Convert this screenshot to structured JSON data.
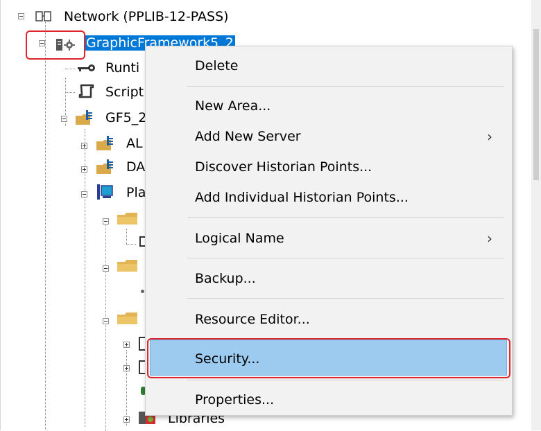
{
  "tree": {
    "root_label": "Network (PPLIB-12-PASS)",
    "selected_label": "GraphicFramework5_2",
    "runtime_label": "Runti",
    "script_label": "Script",
    "gf5_label": "GF5_2",
    "al_label": "AL",
    "da_label": "DA",
    "pla_label": "Pla",
    "libraries_label": "Libraries"
  },
  "context_menu": {
    "items": [
      {
        "label": "Delete",
        "submenu": false
      },
      {
        "label": "New Area...",
        "submenu": false
      },
      {
        "label": "Add New Server",
        "submenu": true
      },
      {
        "label": "Discover Historian Points...",
        "submenu": false
      },
      {
        "label": "Add Individual Historian Points...",
        "submenu": false
      },
      {
        "label": "Logical Name",
        "submenu": true
      },
      {
        "label": "Backup...",
        "submenu": false
      },
      {
        "label": "Resource Editor...",
        "submenu": false
      },
      {
        "label": "Security...",
        "submenu": false,
        "highlighted": true
      },
      {
        "label": "Properties...",
        "submenu": false
      }
    ],
    "submenu_arrow": "›"
  },
  "colors": {
    "selection_bg": "#0078d7",
    "menu_highlight": "#9dcbf0",
    "annotation_red": "#e0242b",
    "menu_bg": "#f2f2f2"
  }
}
